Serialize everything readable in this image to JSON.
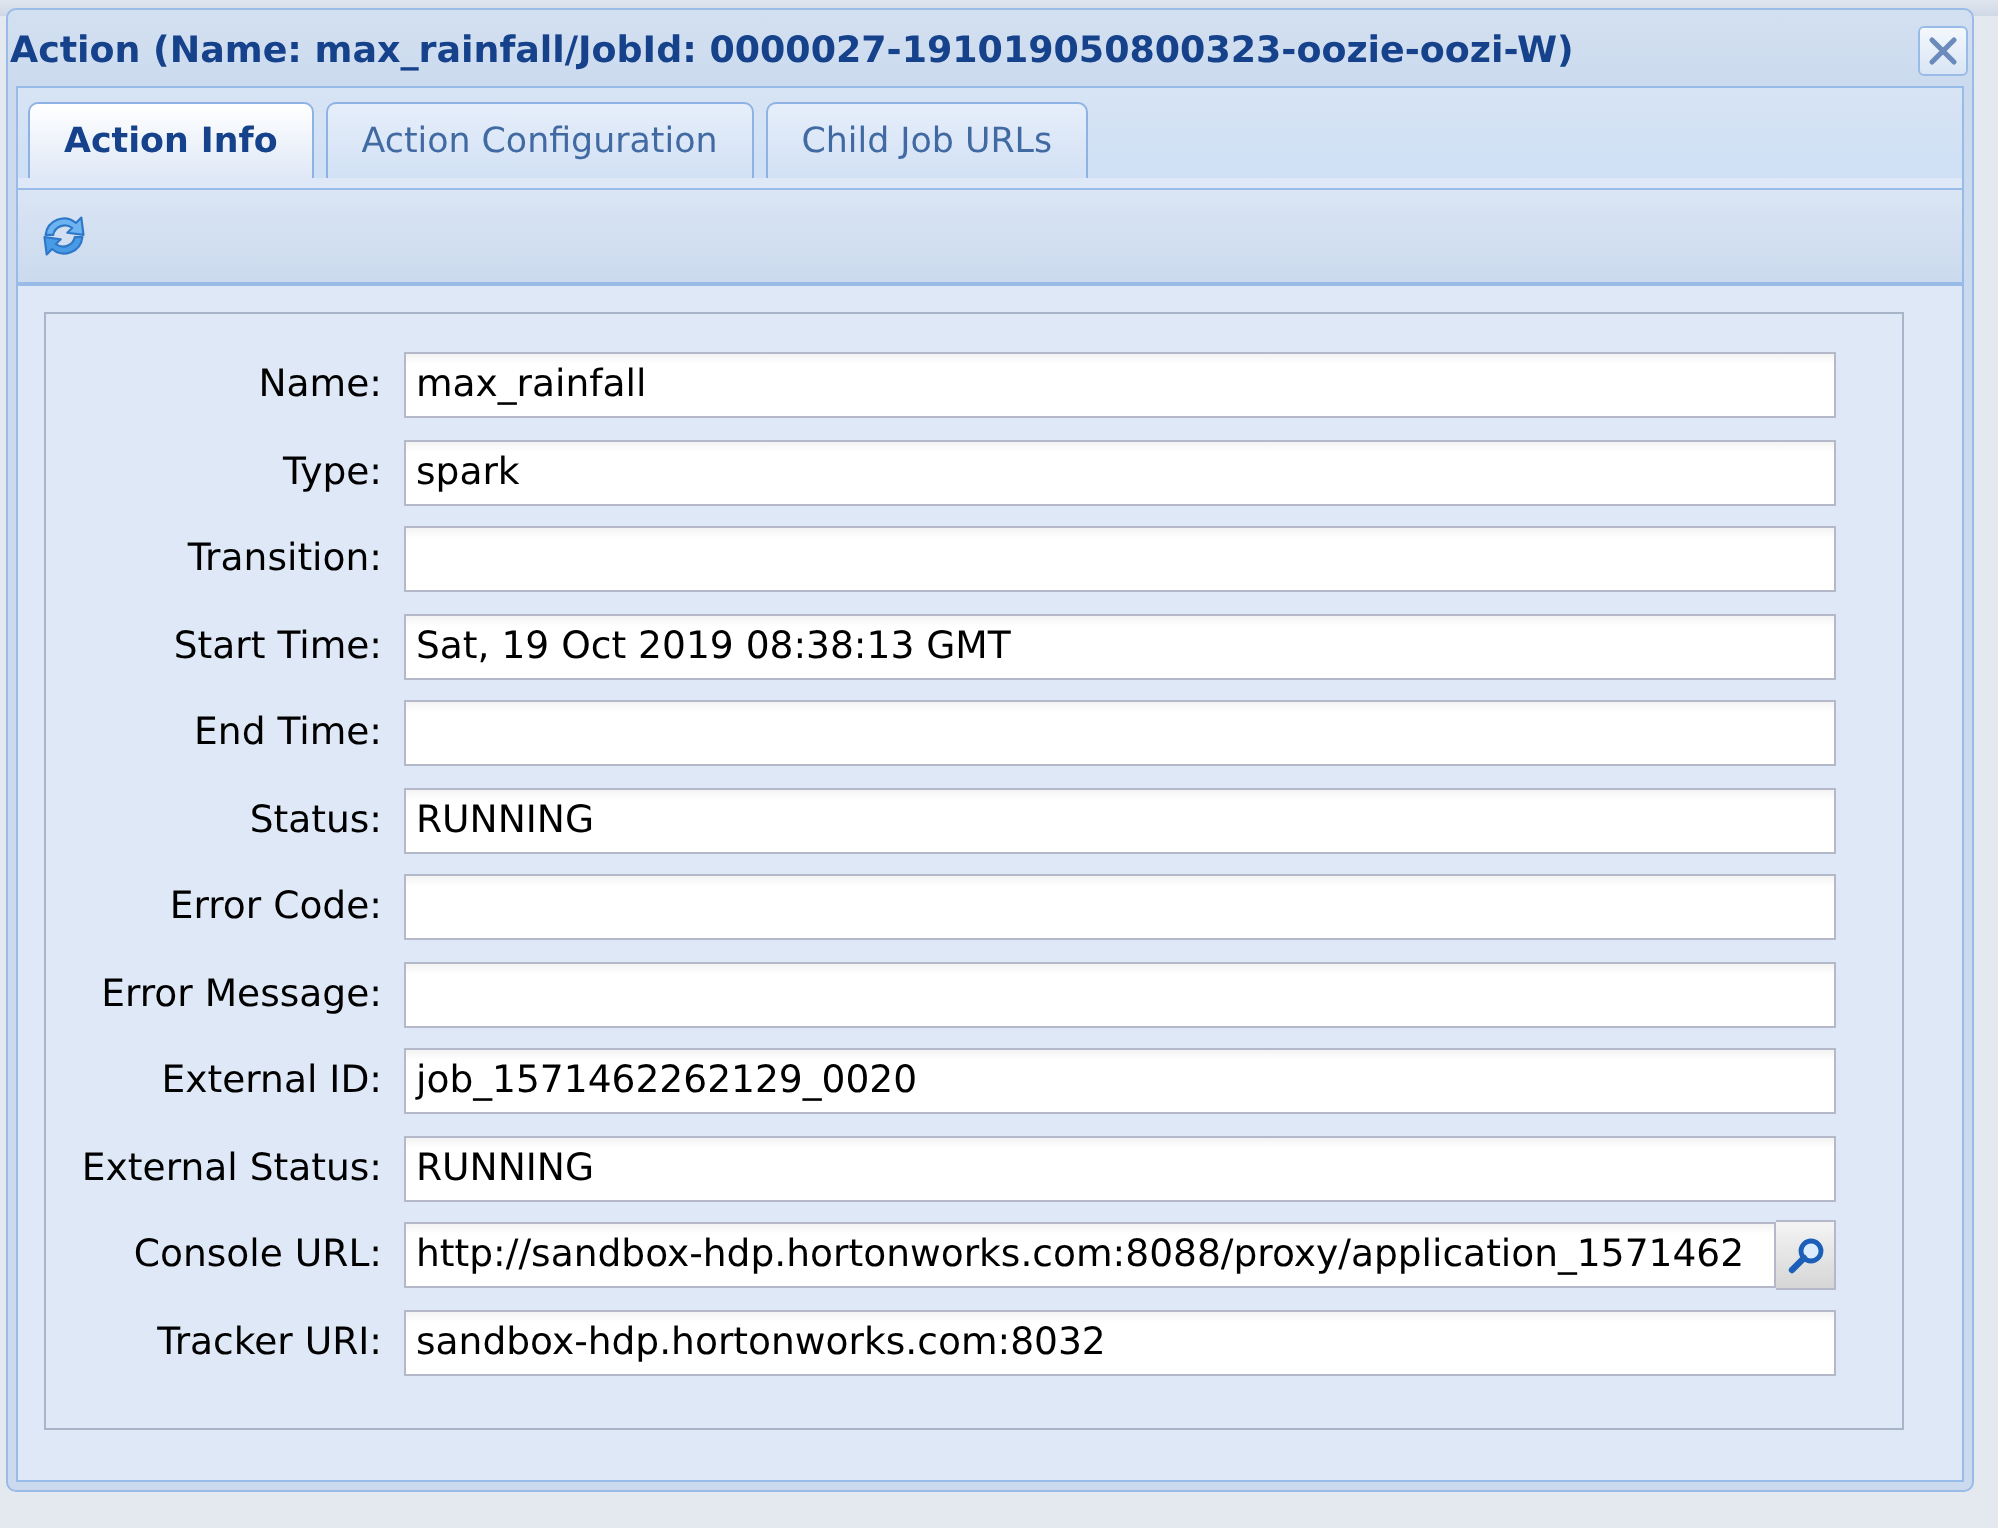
{
  "dialog": {
    "title": "Action (Name: max_rainfall/JobId: 0000027-191019050800323-oozie-oozi-W)"
  },
  "tabs": [
    {
      "label": "Action Info",
      "selected": true
    },
    {
      "label": "Action Configuration",
      "selected": false
    },
    {
      "label": "Child Job URLs",
      "selected": false
    }
  ],
  "fields": [
    {
      "kind": "text",
      "label": "Name:",
      "value": "max_rainfall"
    },
    {
      "kind": "text",
      "label": "Type:",
      "value": "spark"
    },
    {
      "kind": "text",
      "label": "Transition:"
    },
    {
      "kind": "text",
      "label": "Start Time:",
      "value": "Sat, 19 Oct 2019 08:38:13 GMT"
    },
    {
      "kind": "text",
      "label": "End Time:"
    },
    {
      "kind": "text",
      "label": "Status:",
      "value": "RUNNING"
    },
    {
      "kind": "text",
      "label": "Error Code:"
    },
    {
      "kind": "text",
      "label": "Error Message:"
    },
    {
      "kind": "text",
      "label": "External ID:",
      "value": "job_1571462262129_0020"
    },
    {
      "kind": "text",
      "label": "External Status:",
      "value": "RUNNING"
    },
    {
      "kind": "lookup",
      "label": "Console URL:",
      "value": "http://sandbox-hdp.hortonworks.com:8088/proxy/application_1571462"
    },
    {
      "kind": "text",
      "label": "Tracker URI:",
      "value": "sandbox-hdp.hortonworks.com:8032"
    }
  ]
}
